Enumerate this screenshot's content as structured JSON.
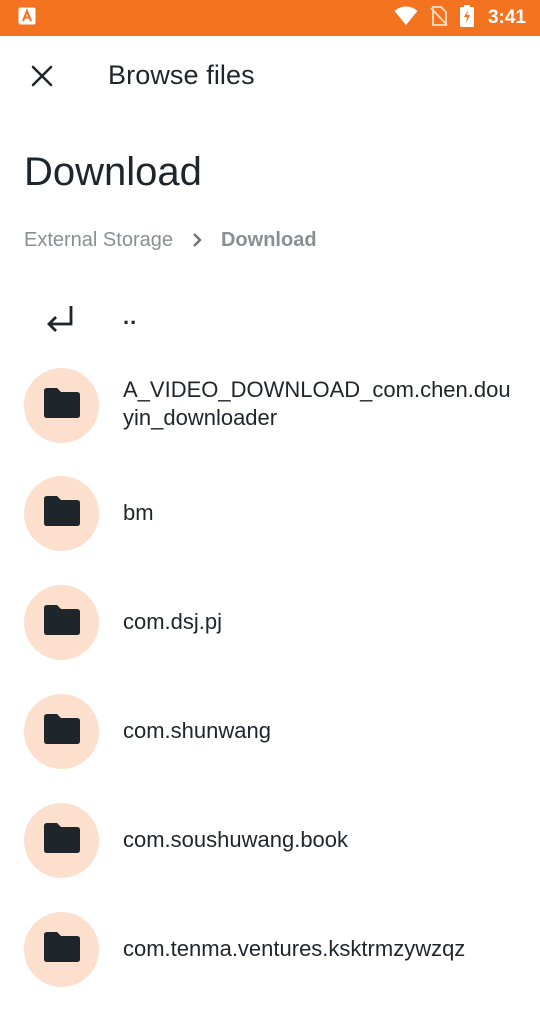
{
  "status_bar": {
    "time": "3:41",
    "icons": [
      "app-notification-icon",
      "wifi-icon",
      "no-sim-icon",
      "battery-charging-icon"
    ],
    "color": "#f47320"
  },
  "app_bar": {
    "title": "Browse files",
    "close_icon": "close-icon"
  },
  "page": {
    "title": "Download"
  },
  "breadcrumb": {
    "items": [
      "External Storage",
      "Download"
    ],
    "separator_icon": "chevron-right-icon"
  },
  "list": {
    "up_label": "..",
    "up_icon": "return-arrow-icon",
    "folders": [
      {
        "name": "A_VIDEO_DOWNLOAD_com.chen.douyin_downloader"
      },
      {
        "name": "bm"
      },
      {
        "name": "com.dsj.pj"
      },
      {
        "name": "com.shunwang"
      },
      {
        "name": "com.soushuwang.book"
      },
      {
        "name": "com.tenma.ventures.ksktrmzywzqz"
      }
    ],
    "folder_icon": "folder-icon",
    "folder_circle_color": "#fce0cd"
  }
}
